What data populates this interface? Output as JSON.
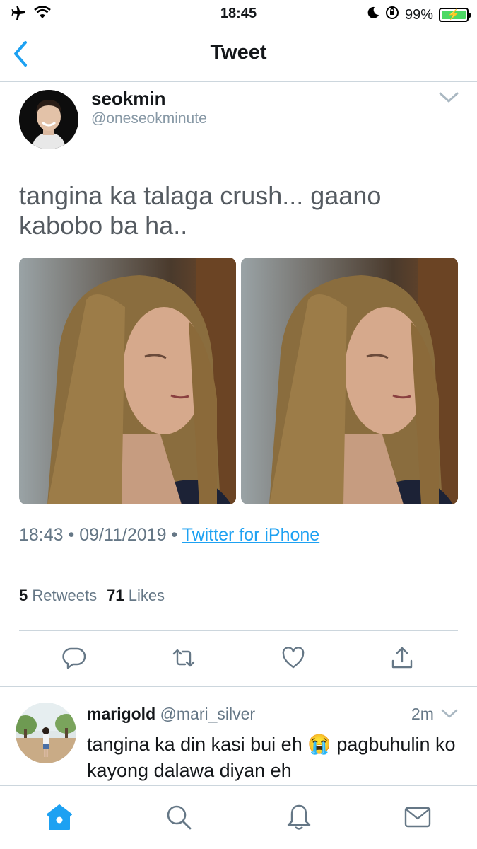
{
  "status_bar": {
    "time": "18:45",
    "battery": "99%",
    "icons": [
      "airplane-icon",
      "wifi-icon",
      "moon-icon",
      "orientation-lock-icon",
      "battery-icon"
    ]
  },
  "nav": {
    "title": "Tweet",
    "back_icon": "chevron-left-icon"
  },
  "tweet": {
    "author_name": "seokmin",
    "author_handle": "@oneseokminute",
    "text": "tangina ka talaga crush... gaano kabobo ba ha..",
    "timestamp": "18:43 • 09/11/2019 • ",
    "source": "Twitter for iPhone",
    "retweet_count": "5",
    "retweet_label": "Retweets",
    "like_count": "71",
    "like_label": "Likes",
    "actions": [
      "reply-icon",
      "retweet-icon",
      "like-icon",
      "share-icon"
    ]
  },
  "reply": {
    "author_name": "marigold",
    "author_handle": "@mari_silver",
    "time": "2m",
    "text": "tangina ka din kasi bui eh 😭 pagbuhulin ko kayong dalawa diyan eh"
  },
  "tab_bar": {
    "tabs": [
      "home-icon",
      "search-icon",
      "notifications-icon",
      "messages-icon"
    ],
    "active": "home-icon",
    "accent": "#1da1f2"
  }
}
